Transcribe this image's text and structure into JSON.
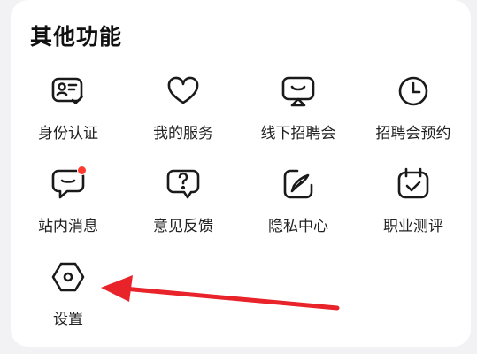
{
  "section": {
    "title": "其他功能"
  },
  "items": [
    {
      "label": "身份认证",
      "icon": "id-card-check-icon"
    },
    {
      "label": "我的服务",
      "icon": "heart-icon"
    },
    {
      "label": "线下招聘会",
      "icon": "presentation-board-icon"
    },
    {
      "label": "招聘会预约",
      "icon": "clock-icon"
    },
    {
      "label": "站内消息",
      "icon": "message-bubble-icon",
      "badge": true
    },
    {
      "label": "意见反馈",
      "icon": "question-bubble-icon"
    },
    {
      "label": "隐私中心",
      "icon": "edit-feather-icon"
    },
    {
      "label": "职业测评",
      "icon": "calendar-check-icon"
    },
    {
      "label": "设置",
      "icon": "hexagon-gear-icon"
    }
  ],
  "colors": {
    "accent_badge": "#ff3b30",
    "annotation_arrow": "#e8232a",
    "icon_stroke": "#1a1a1a"
  }
}
